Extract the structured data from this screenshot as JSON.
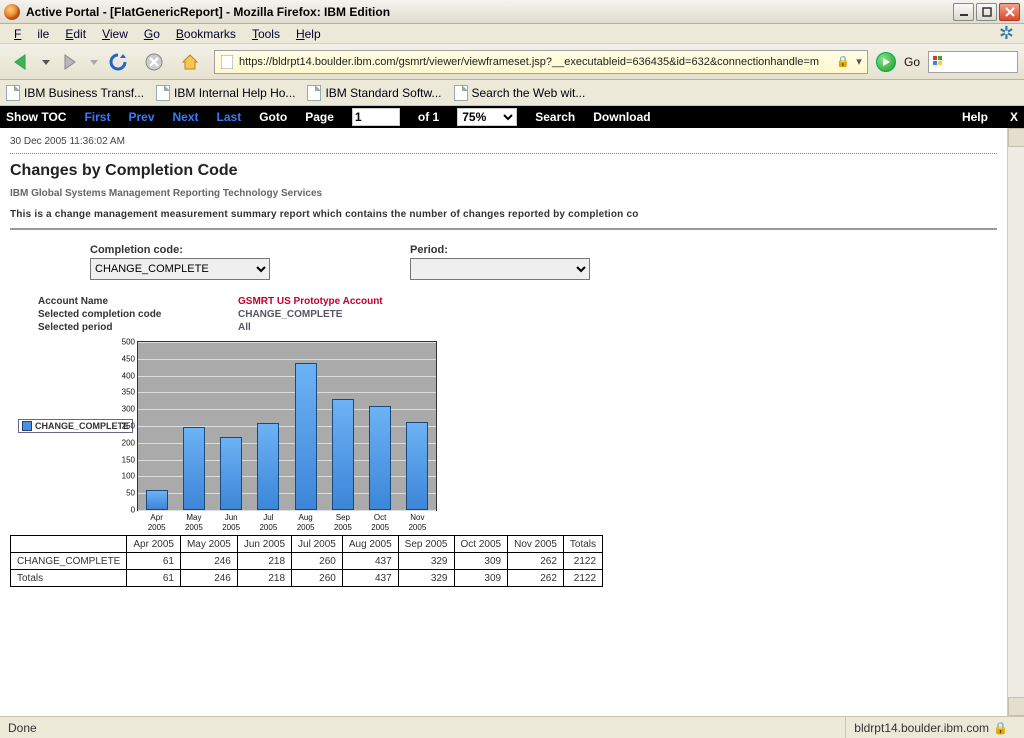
{
  "titlebar": {
    "title": "Active Portal - [FlatGenericReport] - Mozilla Firefox: IBM Edition"
  },
  "menubar": {
    "items": [
      "File",
      "Edit",
      "View",
      "Go",
      "Bookmarks",
      "Tools",
      "Help"
    ]
  },
  "toolbar": {
    "url": "https://bldrpt14.boulder.ibm.com/gsmrt/viewer/viewframeset.jsp?__executableid=636435&id=632&connectionhandle=m",
    "go_label": "Go"
  },
  "bookmarks": {
    "items": [
      "IBM Business Transf...",
      "IBM Internal Help Ho...",
      "IBM Standard Softw...",
      "Search the Web wit..."
    ]
  },
  "viewer": {
    "show_toc": "Show TOC",
    "first": "First",
    "prev": "Prev",
    "next": "Next",
    "last": "Last",
    "goto": "Goto",
    "page_lbl": "Page",
    "page_value": "1",
    "of_lbl": "of 1",
    "zoom": "75%",
    "search": "Search",
    "download": "Download",
    "help": "Help",
    "close": "X"
  },
  "report": {
    "timestamp": "30 Dec 2005 11:36:02 AM",
    "title": "Changes by Completion Code",
    "subtitle": "IBM Global Systems Management Reporting Technology Services",
    "description": "This is a change management measurement summary report which contains the number of changes reported by completion co",
    "filters": {
      "completion_label": "Completion code:",
      "completion_value": "CHANGE_COMPLETE",
      "period_label": "Period:",
      "period_value": ""
    },
    "meta": {
      "account_k": "Account Name",
      "account_v": "GSMRT US Prototype Account",
      "code_k": "Selected completion code",
      "code_v": "CHANGE_COMPLETE",
      "period_k": "Selected period",
      "period_v": "All"
    },
    "legend": "CHANGE_COMPLETE"
  },
  "chart_data": {
    "type": "bar",
    "title": "",
    "categories": [
      "Apr 2005",
      "May 2005",
      "Jun 2005",
      "Jul 2005",
      "Aug 2005",
      "Sep 2005",
      "Oct 2005",
      "Nov 2005"
    ],
    "values": [
      61,
      246,
      218,
      260,
      437,
      329,
      309,
      262
    ],
    "xlabel": "",
    "ylabel": "",
    "ylim": [
      0,
      500
    ],
    "ytick": 50,
    "series_name": "CHANGE_COMPLETE"
  },
  "table": {
    "row_headers": [
      "CHANGE_COMPLETE",
      "Totals"
    ],
    "col_headers": [
      "Apr 2005",
      "May 2005",
      "Jun 2005",
      "Jul 2005",
      "Aug 2005",
      "Sep 2005",
      "Oct 2005",
      "Nov 2005",
      "Totals"
    ],
    "rows": [
      [
        61,
        246,
        218,
        260,
        437,
        329,
        309,
        262,
        2122
      ],
      [
        61,
        246,
        218,
        260,
        437,
        329,
        309,
        262,
        2122
      ]
    ]
  },
  "statusbar": {
    "left": "Done",
    "right": "bldrpt14.boulder.ibm.com"
  }
}
